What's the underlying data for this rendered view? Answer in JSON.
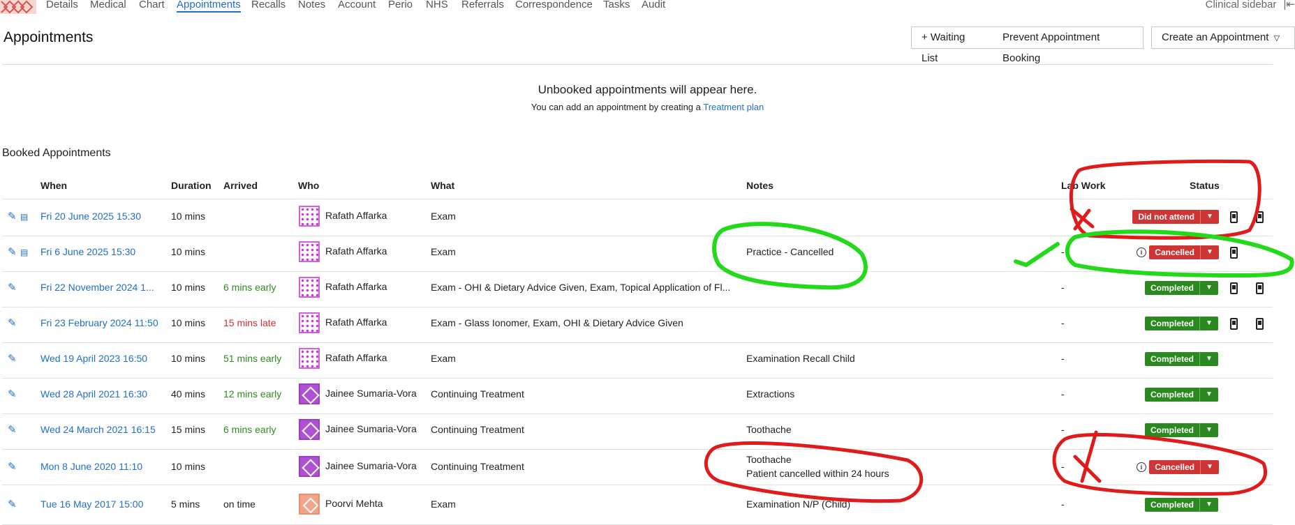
{
  "nav": {
    "tabs": [
      "Details",
      "Medical",
      "Chart",
      "Appointments",
      "Recalls",
      "Notes",
      "Account",
      "Perio",
      "NHS",
      "Referrals",
      "Correspondence",
      "Tasks",
      "Audit"
    ],
    "active_tab": "Appointments",
    "sidebar_label": "Clinical sidebar"
  },
  "page": {
    "title": "Appointments",
    "buttons": {
      "waiting_list": "+ Waiting List",
      "prevent_booking": "Prevent Appointment Booking",
      "create": "Create an Appointment"
    }
  },
  "unbooked": {
    "title": "Unbooked appointments will appear here.",
    "subtitle_prefix": "You can add an appointment by creating a",
    "link_text": "Treatment plan"
  },
  "booked": {
    "title": "Booked Appointments",
    "columns": {
      "when": "When",
      "duration": "Duration",
      "arrived": "Arrived",
      "who": "Who",
      "what": "What",
      "notes": "Notes",
      "lab_work": "Lab Work",
      "status": "Status"
    },
    "rows": [
      {
        "when": "Fri 20 June 2025 15:30",
        "duration": "10 mins",
        "arrived": "",
        "arrived_type": "none",
        "who": "Rafath Affarka",
        "avatar": "rafath",
        "what": "Exam",
        "notes": "",
        "notes2": "",
        "lab": "",
        "status": "Did not attend",
        "status_color": "red",
        "info": false,
        "icons": 2
      },
      {
        "when": "Fri 6 June 2025 15:30",
        "duration": "10 mins",
        "arrived": "",
        "arrived_type": "none",
        "who": "Rafath Affarka",
        "avatar": "rafath",
        "what": "Exam",
        "notes": "Practice - Cancelled",
        "notes2": "",
        "lab": "-",
        "status": "Cancelled",
        "status_color": "red",
        "info": true,
        "icons": 1
      },
      {
        "when": "Fri 22 November 2024 1...",
        "duration": "10 mins",
        "arrived": "6 mins early",
        "arrived_type": "early",
        "who": "Rafath Affarka",
        "avatar": "rafath",
        "what": "Exam - OHI & Dietary Advice Given, Exam, Topical Application of Fl...",
        "notes": "",
        "notes2": "",
        "lab": "-",
        "status": "Completed",
        "status_color": "green",
        "info": false,
        "icons": 2
      },
      {
        "when": "Fri 23 February 2024 11:50",
        "duration": "10 mins",
        "arrived": "15 mins late",
        "arrived_type": "late",
        "who": "Rafath Affarka",
        "avatar": "rafath",
        "what": "Exam - Glass Ionomer, Exam, OHI & Dietary Advice Given",
        "notes": "",
        "notes2": "",
        "lab": "-",
        "status": "Completed",
        "status_color": "green",
        "info": false,
        "icons": 2
      },
      {
        "when": "Wed 19 April 2023 16:50",
        "duration": "10 mins",
        "arrived": "51 mins early",
        "arrived_type": "early",
        "who": "Rafath Affarka",
        "avatar": "rafath",
        "what": "Exam",
        "notes": "Examination Recall Child",
        "notes2": "",
        "lab": "-",
        "status": "Completed",
        "status_color": "green",
        "info": false,
        "icons": 0
      },
      {
        "when": "Wed 28 April 2021 16:30",
        "duration": "40 mins",
        "arrived": "12 mins early",
        "arrived_type": "early",
        "who": "Jainee Sumaria-Vora",
        "avatar": "jainee",
        "what": "Continuing Treatment",
        "notes": "Extractions",
        "notes2": "",
        "lab": "-",
        "status": "Completed",
        "status_color": "green",
        "info": false,
        "icons": 0
      },
      {
        "when": "Wed 24 March 2021 16:15",
        "duration": "15 mins",
        "arrived": "6 mins early",
        "arrived_type": "early",
        "who": "Jainee Sumaria-Vora",
        "avatar": "jainee",
        "what": "Continuing Treatment",
        "notes": "Toothache",
        "notes2": "",
        "lab": "-",
        "status": "Completed",
        "status_color": "green",
        "info": false,
        "icons": 0
      },
      {
        "when": "Mon 8 June 2020 11:10",
        "duration": "10 mins",
        "arrived": "",
        "arrived_type": "none",
        "who": "Jainee Sumaria-Vora",
        "avatar": "jainee",
        "what": "Continuing Treatment",
        "notes": "Toothache",
        "notes2": "Patient cancelled within 24 hours",
        "lab": "-",
        "status": "Cancelled",
        "status_color": "red",
        "info": true,
        "icons": 0
      },
      {
        "when": "Tue 16 May 2017 15:00",
        "duration": "5 mins",
        "arrived": "on time",
        "arrived_type": "none",
        "who": "Poorvi Mehta",
        "avatar": "poorvi",
        "what": "Exam",
        "notes": "Examination N/P (Child)",
        "notes2": "",
        "lab": "-",
        "status": "Completed",
        "status_color": "green",
        "info": false,
        "icons": 0
      }
    ]
  },
  "colors": {
    "link": "#1f6fc9",
    "completed": "#2a8a1f",
    "cancelled": "#cf3535",
    "early": "#2e8b1e",
    "late": "#d32f2f",
    "annotation_red": "#e01b1b",
    "annotation_green": "#22d91a"
  }
}
